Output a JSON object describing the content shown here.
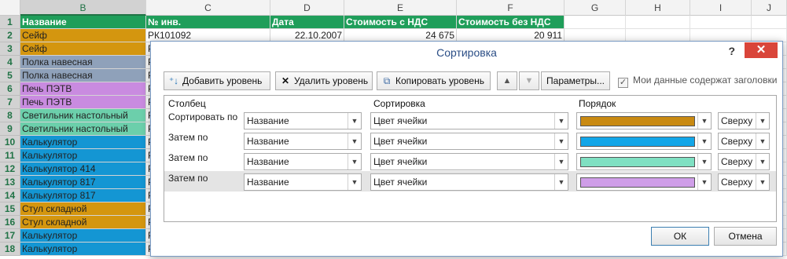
{
  "sheet": {
    "columns": [
      "B",
      "C",
      "D",
      "E",
      "F",
      "G",
      "H",
      "I",
      "J"
    ],
    "selected_column": "B",
    "rows": [
      {
        "n": "1",
        "b": "Название",
        "c": "№ инв.",
        "d": "Дата",
        "e": "Стоимость с НДС",
        "f": "Стоимость без НДС",
        "header": true
      },
      {
        "n": "2",
        "b": "Сейф",
        "c": "РК101092",
        "d": "22.10.2007",
        "e": "24 675",
        "f": "20 911",
        "color": "#d4960f"
      },
      {
        "n": "3",
        "b": "Сейф",
        "c": "Р",
        "color": "#d4960f"
      },
      {
        "n": "4",
        "b": "Полка навесная",
        "c": "Р",
        "color": "#8fa1ba"
      },
      {
        "n": "5",
        "b": "Полка навесная",
        "c": "Р",
        "color": "#8fa1ba"
      },
      {
        "n": "6",
        "b": "Печь ПЭТВ",
        "c": "Р",
        "color": "#c98be0"
      },
      {
        "n": "7",
        "b": "Печь ПЭТВ",
        "c": "Р",
        "color": "#c98be0"
      },
      {
        "n": "8",
        "b": "Светильник настольный",
        "c": "Р",
        "color": "#6ccfab"
      },
      {
        "n": "9",
        "b": "Светильник настольный",
        "c": "Р",
        "color": "#6ccfab"
      },
      {
        "n": "10",
        "b": "Калькулятор",
        "c": "Р",
        "color": "#1496d3"
      },
      {
        "n": "11",
        "b": "Калькулятор",
        "c": "Р",
        "color": "#1496d3"
      },
      {
        "n": "12",
        "b": "Калькулятор 414",
        "c": "Р",
        "color": "#1496d3"
      },
      {
        "n": "13",
        "b": "Калькулятор 817",
        "c": "Р",
        "color": "#1496d3"
      },
      {
        "n": "14",
        "b": "Калькулятор 817",
        "c": "Р",
        "color": "#1496d3"
      },
      {
        "n": "15",
        "b": "Стул складной",
        "c": "Р",
        "color": "#d4960f"
      },
      {
        "n": "16",
        "b": "Стул складной",
        "c": "Р",
        "color": "#d4960f"
      },
      {
        "n": "17",
        "b": "Калькулятор",
        "c": "Р",
        "color": "#1496d3"
      },
      {
        "n": "18",
        "b": "Калькулятор",
        "c": "Р",
        "color": "#1496d3"
      }
    ]
  },
  "dialog": {
    "title": "Сортировка",
    "help": "?",
    "close": "✕",
    "toolbar": {
      "add_level": "Добавить уровень",
      "delete_level": "Удалить уровень",
      "copy_level": "Копировать уровень",
      "move_up": "▲",
      "move_down": "▼",
      "options": "Параметры...",
      "headers_checkbox": "Мои данные содержат заголовки",
      "headers_checked": "✓"
    },
    "columns_header": {
      "column": "Столбец",
      "sort_on": "Сортировка",
      "order": "Порядок"
    },
    "levels": [
      {
        "label": "Сортировать по",
        "column": "Название",
        "sort_on": "Цвет ячейки",
        "color": "#c98a12",
        "position": "Сверху",
        "selected": false
      },
      {
        "label": "Затем по",
        "column": "Название",
        "sort_on": "Цвет ячейки",
        "color": "#12a6e8",
        "position": "Сверху",
        "selected": false
      },
      {
        "label": "Затем по",
        "column": "Название",
        "sort_on": "Цвет ячейки",
        "color": "#7fe0c2",
        "position": "Сверху",
        "selected": false
      },
      {
        "label": "Затем по",
        "column": "Название",
        "sort_on": "Цвет ячейки",
        "color": "#cf9ee8",
        "position": "Сверху",
        "selected": true
      }
    ],
    "ok": "ОК",
    "cancel": "Отмена"
  }
}
